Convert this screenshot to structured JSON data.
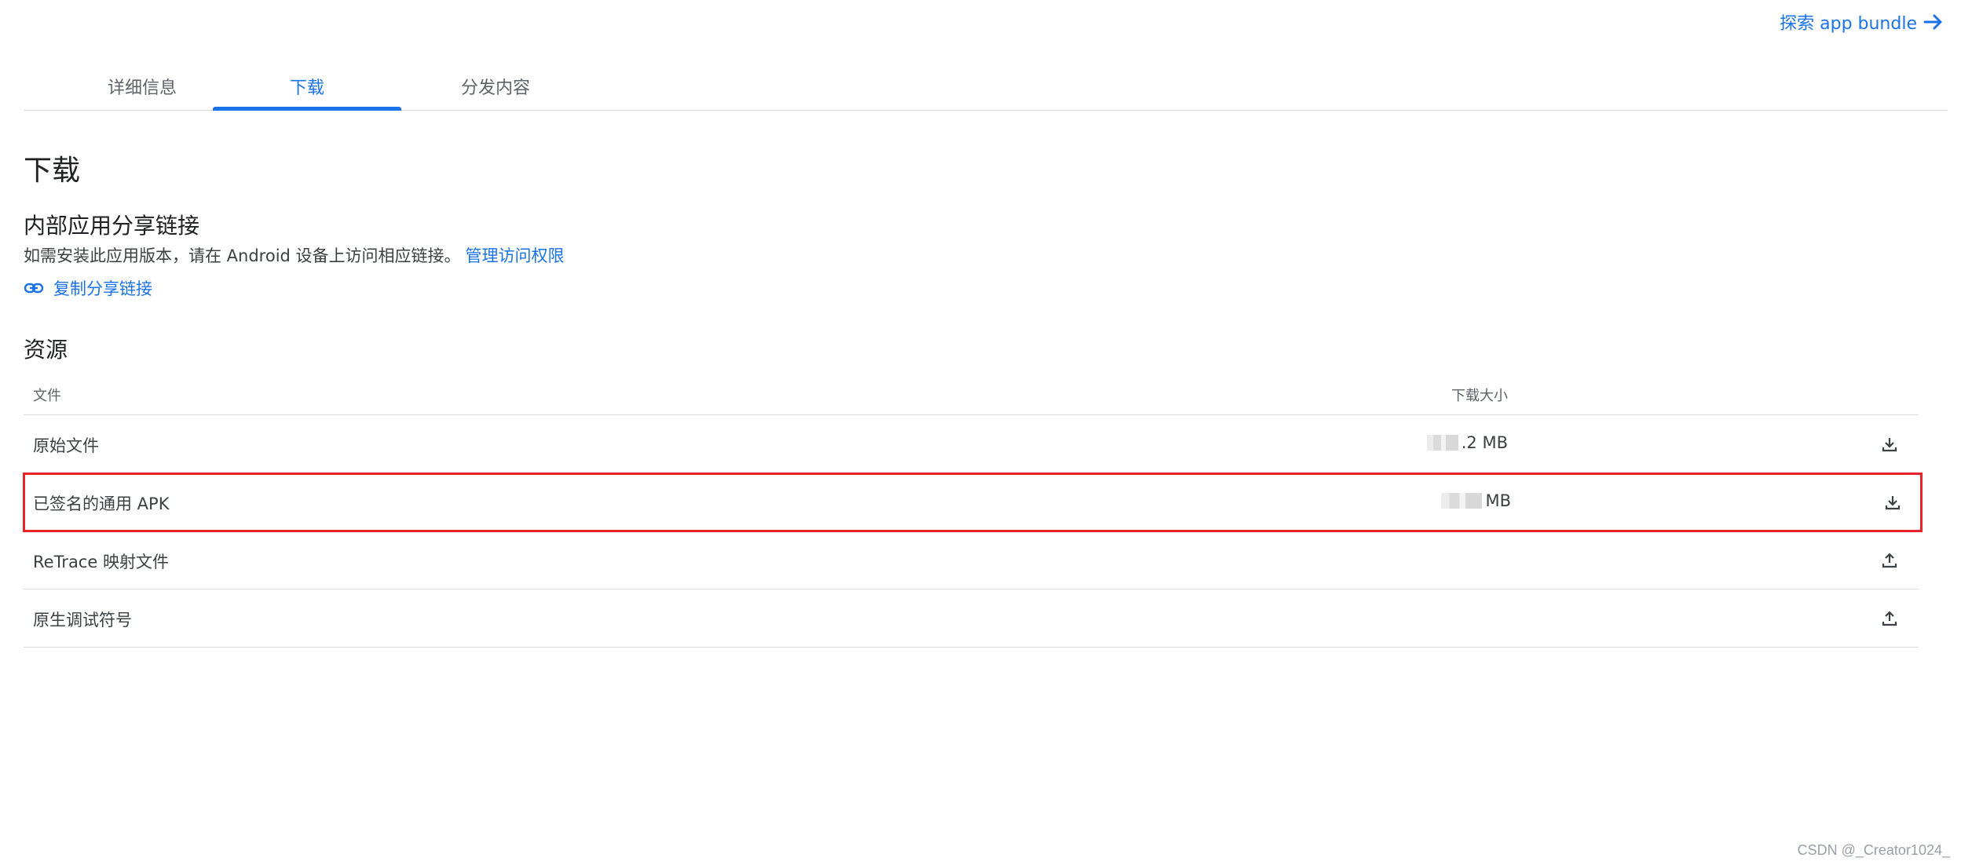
{
  "header": {
    "explore_label": "探索 app bundle"
  },
  "tabs": [
    {
      "label": "详细信息"
    },
    {
      "label": "下载"
    },
    {
      "label": "分发内容"
    }
  ],
  "page_title": "下载",
  "share": {
    "title": "内部应用分享链接",
    "description": "如需安装此应用版本，请在 Android 设备上访问相应链接。",
    "manage_link": "管理访问权限",
    "copy_label": "复制分享链接"
  },
  "assets": {
    "title": "资源",
    "columns": {
      "file": "文件",
      "size": "下载大小"
    },
    "rows": [
      {
        "name": "原始文件",
        "size": ".2 MB",
        "action": "download-icon"
      },
      {
        "name": "已签名的通用 APK",
        "size": "MB",
        "action": "download-icon"
      },
      {
        "name": "ReTrace 映射文件",
        "size": "",
        "action": "upload-icon"
      },
      {
        "name": "原生调试符号",
        "size": "",
        "action": "upload-icon"
      }
    ]
  },
  "watermark": "CSDN @_Creator1024_",
  "colors": {
    "accent": "#1a73e8",
    "highlight_border": "#e8202a",
    "divider": "#dadce0"
  }
}
